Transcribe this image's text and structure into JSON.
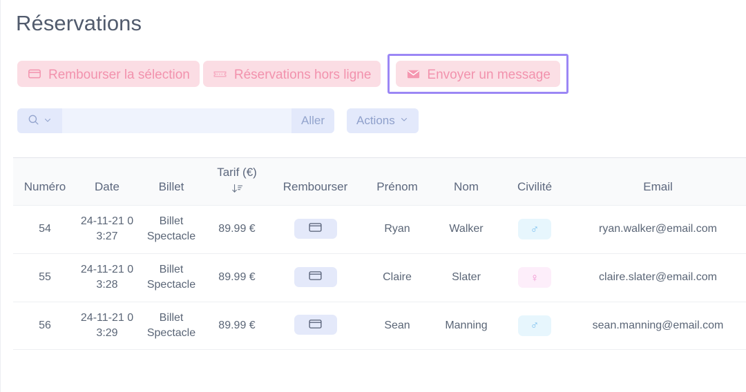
{
  "page": {
    "title": "Réservations"
  },
  "toolbar_actions": {
    "buttons": [
      {
        "label": "Rembourser la sélection",
        "icon": "credit-card-icon",
        "focused": false
      },
      {
        "label": "Réservations hors ligne",
        "icon": "ticket-icon",
        "focused": false
      },
      {
        "label": "Envoyer un message",
        "icon": "envelope-icon",
        "focused": true
      }
    ]
  },
  "search": {
    "icon": "search-icon",
    "chevron_icon": "chevron-down-icon",
    "value": "",
    "placeholder": "",
    "go_label": "Aller",
    "actions_label": "Actions",
    "actions_chevron_icon": "chevron-down-icon"
  },
  "table": {
    "columns": [
      {
        "key": "numero",
        "label": "Numéro"
      },
      {
        "key": "date",
        "label": "Date"
      },
      {
        "key": "billet",
        "label": "Billet"
      },
      {
        "key": "tarif",
        "label": "Tarif (€)",
        "sort_icon": "sort-descending-icon",
        "sorted": "desc"
      },
      {
        "key": "rembourser",
        "label": "Rembourser"
      },
      {
        "key": "prenom",
        "label": "Prénom"
      },
      {
        "key": "nom",
        "label": "Nom"
      },
      {
        "key": "civilite",
        "label": "Civilité"
      },
      {
        "key": "email",
        "label": "Email"
      }
    ],
    "rows": [
      {
        "numero": "54",
        "date": "24-11-21 03:27",
        "billet": "Billet Spectacle",
        "tarif": "89.99 €",
        "rembourser_icon": "credit-card-icon",
        "prenom": "Ryan",
        "nom": "Walker",
        "civilite": "♂",
        "civilite_kind": "male",
        "email": "ryan.walker@email.com"
      },
      {
        "numero": "55",
        "date": "24-11-21 03:28",
        "billet": "Billet Spectacle",
        "tarif": "89.99 €",
        "rembourser_icon": "credit-card-icon",
        "prenom": "Claire",
        "nom": "Slater",
        "civilite": "♀",
        "civilite_kind": "female",
        "email": "claire.slater@email.com"
      },
      {
        "numero": "56",
        "date": "24-11-21 03:29",
        "billet": "Billet Spectacle",
        "tarif": "89.99 €",
        "rembourser_icon": "credit-card-icon",
        "prenom": "Sean",
        "nom": "Manning",
        "civilite": "♂",
        "civilite_kind": "male",
        "email": "sean.manning@email.com"
      }
    ]
  },
  "colors": {
    "accent_pink": "#f292ad",
    "pill_bg": "#fbdde4",
    "focus_ring": "#9b87f5",
    "toolbar_blue": "#e3e9fb",
    "input_blue": "#eff3fd",
    "badge_male_bg": "#e7f6fd",
    "badge_male_fg": "#7cc0ef",
    "badge_female_bg": "#fdeefa",
    "badge_female_fg": "#f08fce",
    "text": "#5a6576",
    "header_bg": "#f9fafb"
  }
}
